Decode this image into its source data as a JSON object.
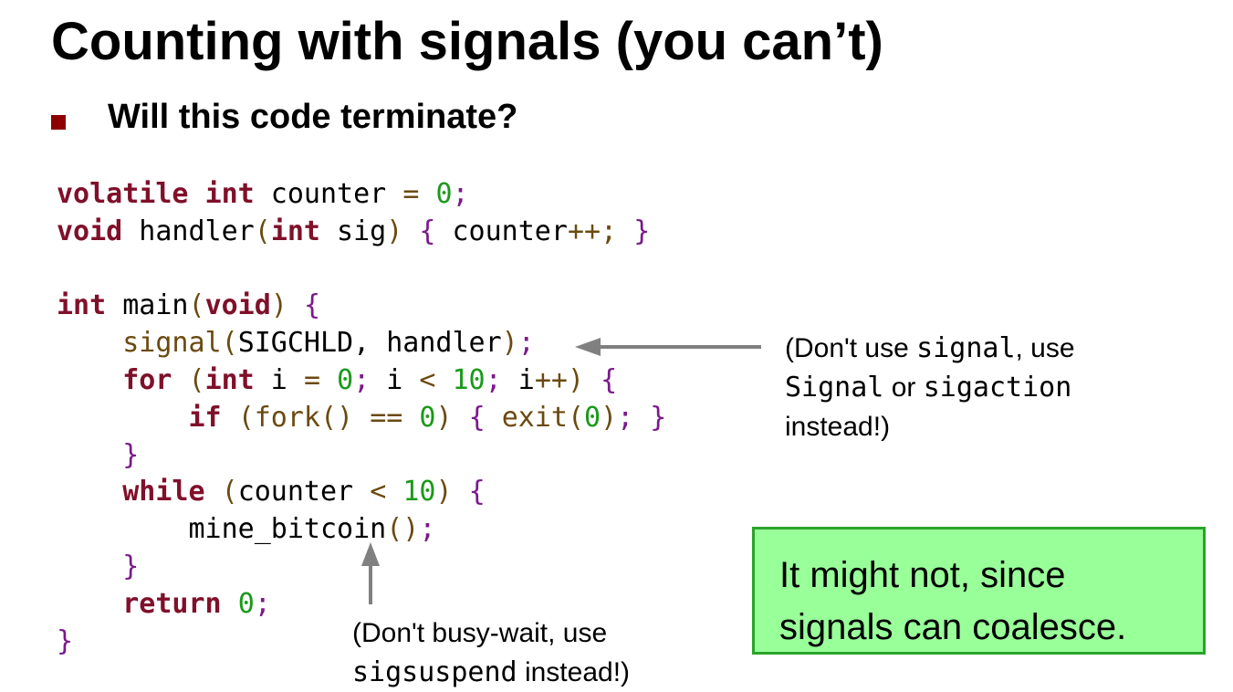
{
  "slide": {
    "title": "Counting with signals (you can’t)",
    "bullet": "Will this code terminate?"
  },
  "code_lines": [
    [
      {
        "t": "volatile",
        "c": "kw"
      },
      {
        "t": " "
      },
      {
        "t": "int",
        "c": "kw"
      },
      {
        "t": " counter "
      },
      {
        "t": "=",
        "c": "op"
      },
      {
        "t": " "
      },
      {
        "t": "0",
        "c": "num"
      },
      {
        "t": ";",
        "c": "pu"
      }
    ],
    [
      {
        "t": "void",
        "c": "kw"
      },
      {
        "t": " handler"
      },
      {
        "t": "(",
        "c": "fn"
      },
      {
        "t": "int",
        "c": "kw"
      },
      {
        "t": " sig"
      },
      {
        "t": ")",
        "c": "fn"
      },
      {
        "t": " "
      },
      {
        "t": "{",
        "c": "pu"
      },
      {
        "t": " counter"
      },
      {
        "t": "++;",
        "c": "op"
      },
      {
        "t": " "
      },
      {
        "t": "}",
        "c": "pu"
      }
    ],
    [],
    [
      {
        "t": "int",
        "c": "kw"
      },
      {
        "t": " main"
      },
      {
        "t": "(",
        "c": "fn"
      },
      {
        "t": "void",
        "c": "kw"
      },
      {
        "t": ")",
        "c": "fn"
      },
      {
        "t": " "
      },
      {
        "t": "{",
        "c": "pu"
      }
    ],
    [
      {
        "t": "    "
      },
      {
        "t": "signal",
        "c": "fn"
      },
      {
        "t": "(",
        "c": "fn"
      },
      {
        "t": "SIGCHLD, handler"
      },
      {
        "t": ")",
        "c": "fn"
      },
      {
        "t": ";",
        "c": "pu"
      }
    ],
    [
      {
        "t": "    "
      },
      {
        "t": "for",
        "c": "kw"
      },
      {
        "t": " "
      },
      {
        "t": "(",
        "c": "fn"
      },
      {
        "t": "int",
        "c": "kw"
      },
      {
        "t": " i "
      },
      {
        "t": "=",
        "c": "op"
      },
      {
        "t": " "
      },
      {
        "t": "0",
        "c": "num"
      },
      {
        "t": ";",
        "c": "pu"
      },
      {
        "t": " i "
      },
      {
        "t": "<",
        "c": "op"
      },
      {
        "t": " "
      },
      {
        "t": "10",
        "c": "num"
      },
      {
        "t": ";",
        "c": "pu"
      },
      {
        "t": " i"
      },
      {
        "t": "++",
        "c": "op"
      },
      {
        "t": ")",
        "c": "fn"
      },
      {
        "t": " "
      },
      {
        "t": "{",
        "c": "pu"
      }
    ],
    [
      {
        "t": "        "
      },
      {
        "t": "if",
        "c": "kw"
      },
      {
        "t": " "
      },
      {
        "t": "(",
        "c": "fn"
      },
      {
        "t": "fork",
        "c": "fn"
      },
      {
        "t": "()",
        "c": "fn"
      },
      {
        "t": " "
      },
      {
        "t": "==",
        "c": "op"
      },
      {
        "t": " "
      },
      {
        "t": "0",
        "c": "num"
      },
      {
        "t": ")",
        "c": "fn"
      },
      {
        "t": " "
      },
      {
        "t": "{",
        "c": "pu"
      },
      {
        "t": " "
      },
      {
        "t": "exit",
        "c": "fn"
      },
      {
        "t": "(",
        "c": "fn"
      },
      {
        "t": "0",
        "c": "num"
      },
      {
        "t": ")",
        "c": "fn"
      },
      {
        "t": ";",
        "c": "pu"
      },
      {
        "t": " "
      },
      {
        "t": "}",
        "c": "pu"
      }
    ],
    [
      {
        "t": "    "
      },
      {
        "t": "}",
        "c": "pu"
      }
    ],
    [
      {
        "t": "    "
      },
      {
        "t": "while",
        "c": "kw"
      },
      {
        "t": " "
      },
      {
        "t": "(",
        "c": "fn"
      },
      {
        "t": "counter "
      },
      {
        "t": "<",
        "c": "op"
      },
      {
        "t": " "
      },
      {
        "t": "10",
        "c": "num"
      },
      {
        "t": ")",
        "c": "fn"
      },
      {
        "t": " "
      },
      {
        "t": "{",
        "c": "pu"
      }
    ],
    [
      {
        "t": "        mine_bitcoin"
      },
      {
        "t": "()",
        "c": "fn"
      },
      {
        "t": ";",
        "c": "pu"
      }
    ],
    [
      {
        "t": "    "
      },
      {
        "t": "}",
        "c": "pu"
      }
    ],
    [
      {
        "t": "    "
      },
      {
        "t": "return",
        "c": "kw"
      },
      {
        "t": " "
      },
      {
        "t": "0",
        "c": "num"
      },
      {
        "t": ";",
        "c": "pu"
      }
    ],
    [
      {
        "t": "}",
        "c": "pu"
      }
    ]
  ],
  "note_signal": {
    "l1a": "(Don't use ",
    "l1b": "signal",
    "l1c": ", use",
    "l2a": "Signal",
    "l2b": " or ",
    "l2c": "sigaction",
    "l3": "instead!)"
  },
  "note_busywait": {
    "l1": "(Don't busy-wait, use",
    "l2a": "sigsuspend",
    "l2b": " instead!)"
  },
  "answer": {
    "line1": "It might not, since",
    "line2": "signals can coalesce."
  },
  "colors": {
    "keyword": "#80102a",
    "function": "#6b4a10",
    "number": "#1a9a1a",
    "punctuation": "#7a1a8a",
    "bullet": "#8e0000",
    "answer_bg": "#99ff99",
    "answer_border": "#2aa32a",
    "arrow": "#808080"
  }
}
